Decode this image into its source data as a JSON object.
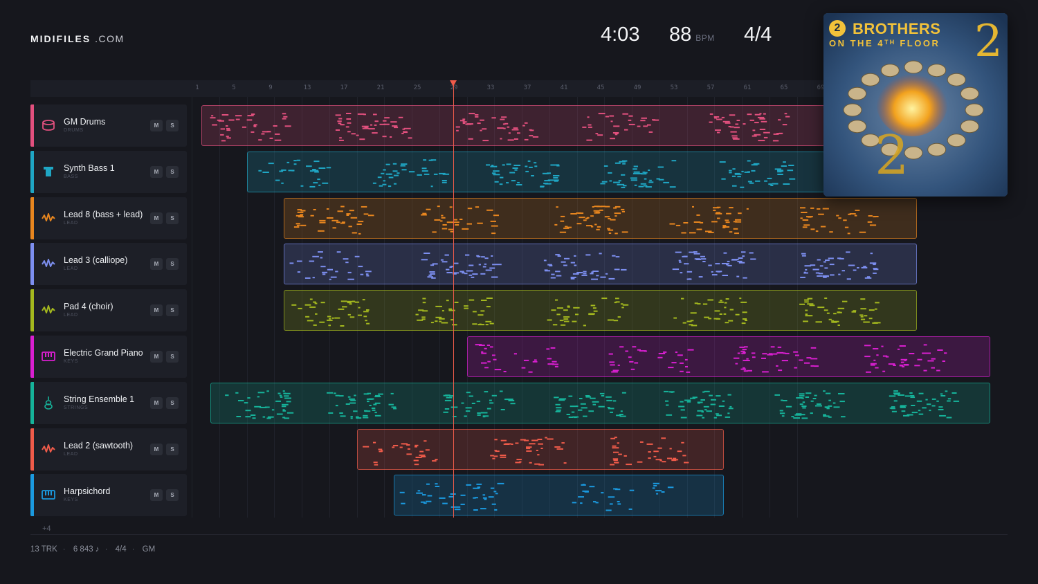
{
  "brand": {
    "name": "MIDIFILES",
    "domain": ".COM"
  },
  "header": {
    "duration": "4:03",
    "tempo": "88",
    "tempo_unit": "BPM",
    "time_signature": "4/4"
  },
  "ruler": {
    "ticks": [
      "1",
      "5",
      "9",
      "13",
      "17",
      "21",
      "25",
      "29",
      "33",
      "37",
      "41",
      "45",
      "49",
      "53",
      "57",
      "61",
      "65",
      "69"
    ]
  },
  "tracks": [
    {
      "name": "GM Drums",
      "category": "DRUMS",
      "color": "#e2507e",
      "icon": "drum-icon",
      "mute": "M",
      "solo": "S"
    },
    {
      "name": "Synth Bass 1",
      "category": "BASS",
      "color": "#1fa6c4",
      "icon": "bass-icon",
      "mute": "M",
      "solo": "S"
    },
    {
      "name": "Lead 8 (bass + lead)",
      "category": "LEAD",
      "color": "#e8861f",
      "icon": "waveform-icon",
      "mute": "M",
      "solo": "S"
    },
    {
      "name": "Lead 3 (calliope)",
      "category": "LEAD",
      "color": "#7d8ff0",
      "icon": "waveform-icon",
      "mute": "M",
      "solo": "S"
    },
    {
      "name": "Pad 4 (choir)",
      "category": "LEAD",
      "color": "#a4b81e",
      "icon": "waveform-icon",
      "mute": "M",
      "solo": "S"
    },
    {
      "name": "Electric Grand Piano",
      "category": "KEYS",
      "color": "#d91fd0",
      "icon": "piano-icon",
      "mute": "M",
      "solo": "S"
    },
    {
      "name": "String Ensemble 1",
      "category": "STRINGS",
      "color": "#16b39a",
      "icon": "violin-icon",
      "mute": "M",
      "solo": "S"
    },
    {
      "name": "Lead 2 (sawtooth)",
      "category": "LEAD",
      "color": "#ef5b4a",
      "icon": "waveform-icon",
      "mute": "M",
      "solo": "S"
    },
    {
      "name": "Harpsichord",
      "category": "KEYS",
      "color": "#1b9ae0",
      "icon": "piano-icon",
      "mute": "M",
      "solo": "S"
    }
  ],
  "more_tracks": "+4",
  "footer": {
    "tracks": "13 TRK",
    "notes": "6 843 ♪",
    "time_signature": "4/4",
    "standard": "GM"
  },
  "album": {
    "badge": "2",
    "title": "BROTHERS",
    "subtitle": "ON THE 4ᵀᴴ FLOOR",
    "number": "2"
  }
}
